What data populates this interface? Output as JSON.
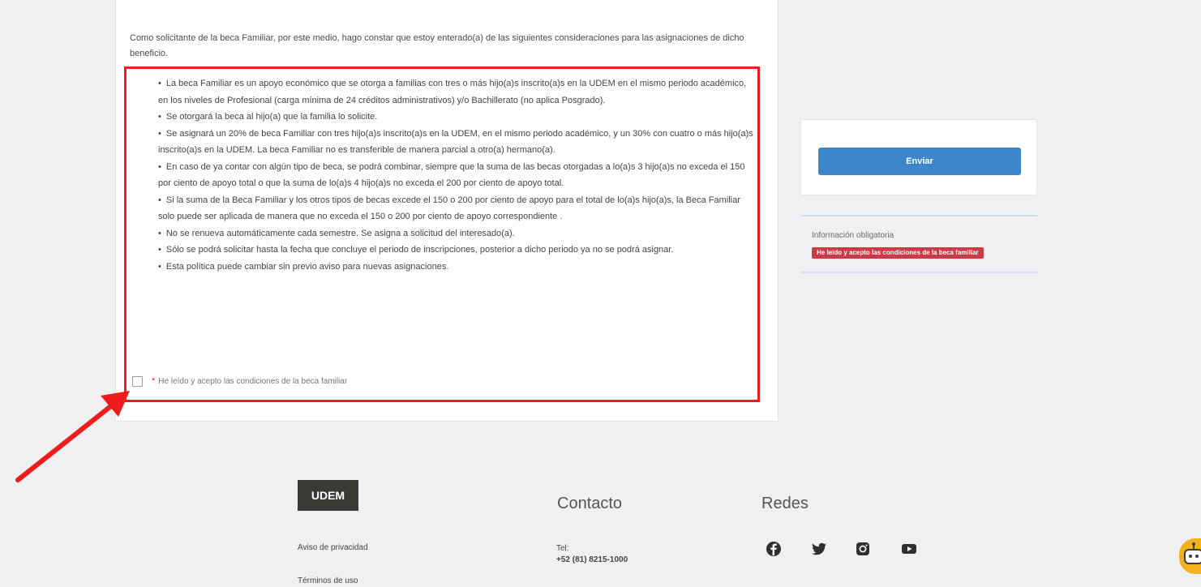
{
  "intro_text": "Como solicitante de la beca Familiar, por este medio, hago constar que estoy enterado(a) de las siguientes consideraciones para las asignaciones de dicho beneficio.",
  "terms": [
    "La beca Familiar es un apoyo económico que se otorga a familias con tres o más hijo(a)s inscrito(a)s en la UDEM en el mismo periodo académico, en los niveles de Profesional (carga mínima de 24 créditos administrativos) y/o Bachillerato (no aplica Posgrado).",
    "Se otorgará la beca al hijo(a) que la familia lo solicite.",
    "Se asignará un 20% de beca Familiar con tres hijo(a)s inscrito(a)s en la UDEM, en el mismo periodo académico, y un 30% con cuatro o más hijo(a)s inscrito(a)s en la UDEM. La beca Familiar no es transferible de manera parcial a otro(a) hermano(a).",
    "En caso de ya contar con algún tipo de beca, se podrá combinar, siempre que la suma de las becas otorgadas a lo(a)s 3 hijo(a)s no exceda el 150 por ciento de apoyo total o que la suma de lo(a)s 4 hijo(a)s no exceda el 200 por ciento de apoyo total.",
    "Si la suma de la Beca Familiar y los otros tipos de becas excede el 150 o 200 por ciento de apoyo para el total de lo(a)s hijo(a)s, la Beca Familiar solo puede ser aplicada de manera que no exceda el 150 o 200 por ciento de apoyo correspondiente .",
    "No se renueva automáticamente cada semestre. Se asigna a solicitud del interesado(a).",
    "Sólo se podrá solicitar hasta la fecha que concluye el periodo de inscripciones, posterior a dicho periodo ya no se podrá asignar.",
    "Esta política puede cambiar sin previo aviso para nuevas asignaciones."
  ],
  "accept": {
    "required_mark": "*",
    "label": "He leído y acepto las condiciones de la beca familiar"
  },
  "submit_label": "Enviar",
  "required_info": {
    "title": "Información obligatoria",
    "error": "He leído y acepto las condiciones de la beca familiar"
  },
  "footer": {
    "logo": "UDEM",
    "contact_heading": "Contacto",
    "social_heading": "Redes",
    "privacy": "Aviso de privacidad",
    "terms_of_use": "Términos de uso",
    "tel_label": "Tel:",
    "phone": "+52 (81) 8215-1000"
  },
  "icons": [
    "facebook-icon",
    "twitter-icon",
    "instagram-icon",
    "youtube-icon",
    "chatbot-icon"
  ],
  "colors": {
    "highlight": "#ee1c1c",
    "button": "#3d86cc",
    "error_badge": "#cc3a45",
    "logo_bg": "#3b3a36"
  }
}
